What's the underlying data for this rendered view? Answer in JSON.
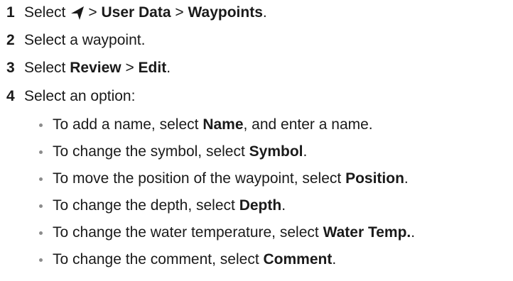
{
  "steps": [
    {
      "number": "1",
      "prefix": "Select",
      "icon": "navigation-arrow-icon",
      "sep1": ">",
      "item1": "User Data",
      "sep2": ">",
      "item2": "Waypoints",
      "end": "."
    },
    {
      "number": "2",
      "text": "Select a waypoint."
    },
    {
      "number": "3",
      "prefix": "Select",
      "item1": "Review",
      "sep1": ">",
      "item2": "Edit",
      "end": "."
    },
    {
      "number": "4",
      "text": "Select an option:"
    }
  ],
  "options": [
    {
      "before": "To add a name, select",
      "bold": "Name",
      "after": ", and enter a name."
    },
    {
      "before": "To change the symbol, select",
      "bold": "Symbol",
      "after": "."
    },
    {
      "before": "To move the position of the waypoint, select",
      "bold": "Position",
      "after": "."
    },
    {
      "before": "To change the depth, select",
      "bold": "Depth",
      "after": "."
    },
    {
      "before": "To change the water temperature, select",
      "bold": "Water Temp.",
      "after": "."
    },
    {
      "before": "To change the comment, select",
      "bold": "Comment",
      "after": "."
    }
  ]
}
